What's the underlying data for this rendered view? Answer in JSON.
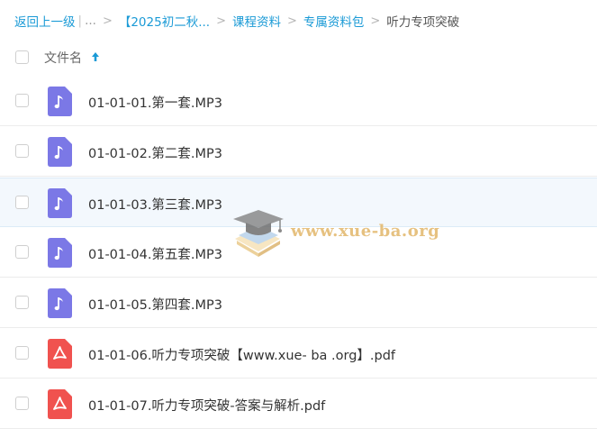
{
  "breadcrumb": {
    "back": "返回上一级",
    "pipe": "|",
    "ellipsis": "...",
    "sep": ">",
    "items": [
      {
        "label": "【2025初二秋..."
      },
      {
        "label": "课程资料"
      },
      {
        "label": "专属资料包"
      },
      {
        "label": "听力专项突破"
      }
    ]
  },
  "header": {
    "column": "文件名",
    "sort": "ascending"
  },
  "files": [
    {
      "name": "01-01-01.第一套.MP3",
      "type": "audio"
    },
    {
      "name": "01-01-02.第二套.MP3",
      "type": "audio"
    },
    {
      "name": "01-01-03.第三套.MP3",
      "type": "audio"
    },
    {
      "name": "01-01-04.第五套.MP3",
      "type": "audio"
    },
    {
      "name": "01-01-05.第四套.MP3",
      "type": "audio"
    },
    {
      "name": "01-01-06.听力专项突破【www.xue- ba .org】.pdf",
      "type": "pdf"
    },
    {
      "name": "01-01-07.听力专项突破-答案与解析.pdf",
      "type": "pdf"
    }
  ],
  "watermark": {
    "text": "www.xue-ba.org"
  },
  "colors": {
    "link": "#1a9ad6",
    "audio_icon": "#7b78e6",
    "pdf_icon": "#f0524f",
    "row_hover": "#f3f8fd"
  }
}
